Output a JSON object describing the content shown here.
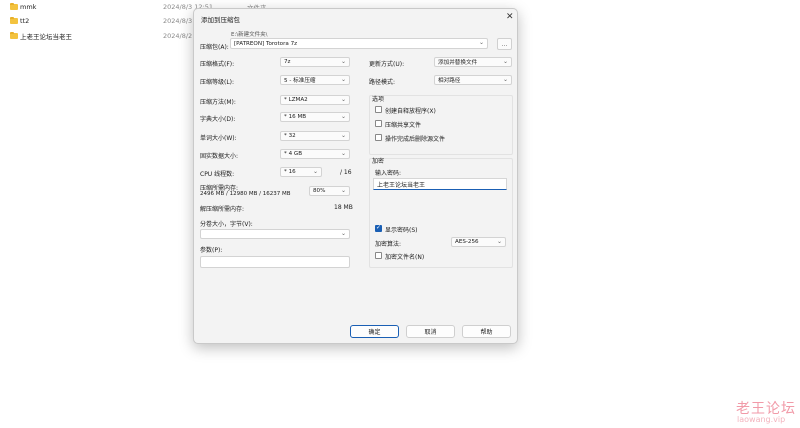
{
  "explorer": {
    "rows": [
      {
        "name": "mmk",
        "date": "2024/8/3 12:51",
        "type": "文件夹"
      },
      {
        "name": "tt2",
        "date": "2024/8/3",
        "type": ""
      },
      {
        "name": "上老王论坛当老王",
        "date": "2024/8/2",
        "type": ""
      }
    ]
  },
  "dialog": {
    "title": "添加到压缩包",
    "close_icon": "close-icon",
    "archive": {
      "label": "压缩包(A):",
      "path_label": "E:\\新建文件夹\\",
      "value": "[PATREON] Torotora 7z",
      "browse_label": "..."
    },
    "left": {
      "format": {
        "label": "压缩格式(F):",
        "value": "7z"
      },
      "level": {
        "label": "压缩等级(L):",
        "value": "5 - 标准压缩"
      },
      "method": {
        "label": "压缩方法(M):",
        "value": "* LZMA2"
      },
      "dict": {
        "label": "字典大小(D):",
        "value": "* 16 MB"
      },
      "word": {
        "label": "单词大小(W):",
        "value": "* 32"
      },
      "solid": {
        "label": "固实数据大小:",
        "value": "* 4 GB"
      },
      "cpu": {
        "label": "CPU 线程数:",
        "value": "* 16",
        "total": "/ 16"
      },
      "mem": {
        "label": "压缩所需内存:",
        "detail": "2496 MB / 12980 MB / 16237 MB",
        "value": "80%"
      },
      "decomp": {
        "label": "解压缩所需内存:",
        "value": "18 MB"
      },
      "split": {
        "label": "分卷大小，字节(V):",
        "value": ""
      },
      "params": {
        "label": "参数(P):",
        "value": ""
      }
    },
    "right": {
      "update": {
        "label": "更新方式(U):",
        "value": "添加并替换文件"
      },
      "path_mode": {
        "label": "路径模式:",
        "value": "相对路径"
      },
      "options": {
        "title": "选项",
        "items": [
          {
            "label": "创建自释放程序(X)",
            "checked": false
          },
          {
            "label": "压缩共享文件",
            "checked": false
          },
          {
            "label": "操作完成后删除源文件",
            "checked": false
          }
        ]
      },
      "encryption": {
        "title": "加密",
        "password_label": "输入密码:",
        "password_value": "上老王论坛当老王",
        "show_password": {
          "label": "显示密码(S)",
          "checked": true
        },
        "method_label": "加密算法:",
        "method_value": "AES-256",
        "encrypt_names": {
          "label": "加密文件名(N)",
          "checked": false
        }
      }
    },
    "buttons": {
      "ok": "确定",
      "cancel": "取消",
      "help": "帮助"
    }
  },
  "watermark": {
    "line1": "老王论坛",
    "line2": "laowang.vip"
  }
}
